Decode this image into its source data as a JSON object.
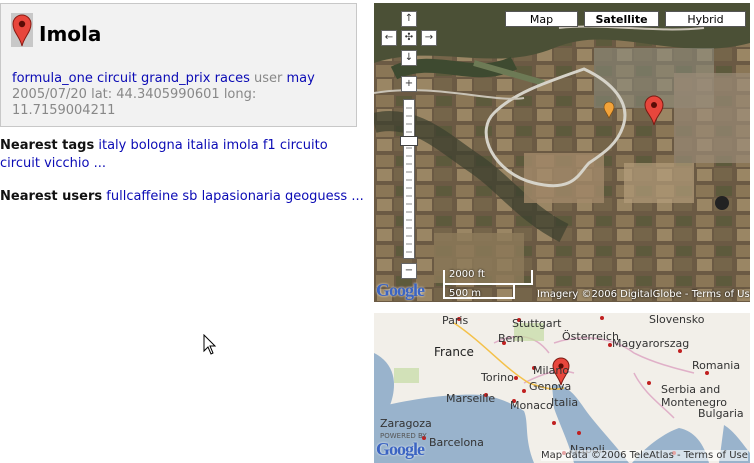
{
  "place": {
    "title": "Imola",
    "tags": [
      "formula_one",
      "circuit",
      "grand_prix",
      "races"
    ],
    "user_label": "user",
    "user": "may",
    "date": "2005/07/20",
    "lat_label": "lat:",
    "lat": "44.3405990601",
    "long_label": "long:",
    "long": "11.7159004211"
  },
  "nearest_tags": {
    "label": "Nearest tags",
    "items": [
      "italy",
      "bologna",
      "italia",
      "imola",
      "f1",
      "circuito",
      "circuit",
      "vicchio"
    ],
    "more": "..."
  },
  "nearest_users": {
    "label": "Nearest users",
    "items": [
      "fullcaffeine",
      "sb",
      "lapasionaria",
      "geoguess"
    ],
    "more": "..."
  },
  "sat_map": {
    "map_types": [
      {
        "label": "Map",
        "selected": false
      },
      {
        "label": "Satellite",
        "selected": true
      },
      {
        "label": "Hybrid",
        "selected": false
      }
    ],
    "scale_ft": "2000 ft",
    "scale_m": "500 m",
    "copyright": "Imagery ©2006 DigitalGlobe - Terms of Use",
    "logo": "Google"
  },
  "road_map": {
    "labels": [
      "Paris",
      "Stuttgart",
      "Österreich",
      "Slovensko",
      "France",
      "Bern",
      "Magyarorszag",
      "Milano",
      "Torino",
      "Genova",
      "Romania",
      "Marseille",
      "Monaco",
      "Italia",
      "Serbia and",
      "Montenegro",
      "Bulgaria",
      "Zaragoza",
      "Barcelona",
      "Napoli"
    ],
    "copyright": "Map data ©2006 TeleAtlas - Terms of Use",
    "logo": "Google",
    "powered": "POWERED BY"
  },
  "colors": {
    "link": "#0b0bb5",
    "marker": "#e8463c",
    "sea": "#99b3cc",
    "land": "#f2efe9"
  }
}
